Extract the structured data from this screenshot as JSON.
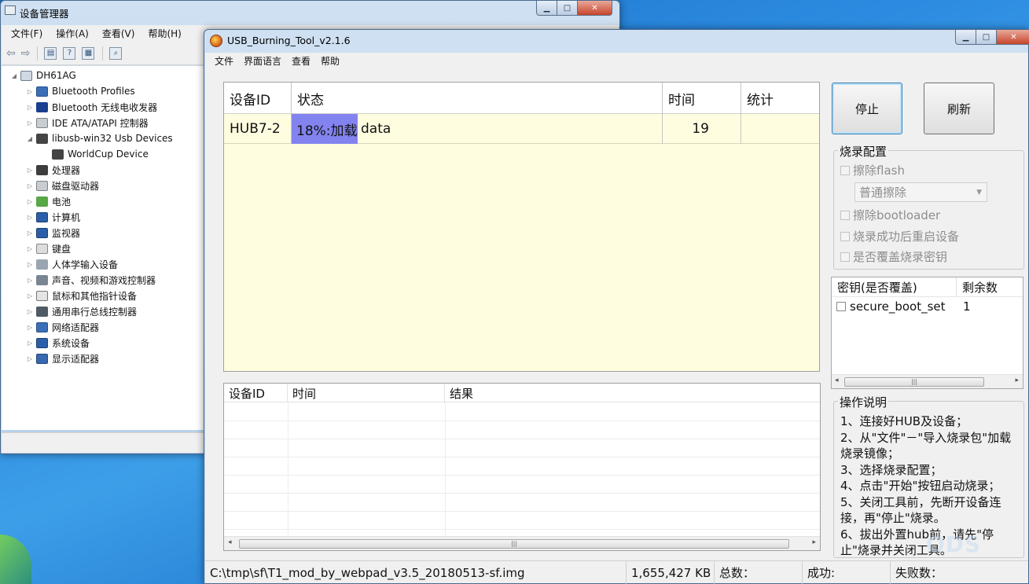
{
  "device_manager": {
    "title": "设备管理器",
    "menu": [
      "文件(F)",
      "操作(A)",
      "查看(V)",
      "帮助(H)"
    ],
    "tree": [
      {
        "label": "DH61AG",
        "icon": "computer-icon",
        "level": 0,
        "expanded": true
      },
      {
        "label": "Bluetooth Profiles",
        "icon": "network-icon",
        "level": 1
      },
      {
        "label": "Bluetooth 无线电收发器",
        "icon": "bluetooth-icon",
        "level": 1
      },
      {
        "label": "IDE ATA/ATAPI 控制器",
        "icon": "drive-controller-icon",
        "level": 1
      },
      {
        "label": "libusb-win32 Usb Devices",
        "icon": "usb-icon",
        "level": 1,
        "expanded": true
      },
      {
        "label": "WorldCup Device",
        "icon": "usb-icon",
        "level": 2
      },
      {
        "label": "处理器",
        "icon": "cpu-icon",
        "level": 1
      },
      {
        "label": "磁盘驱动器",
        "icon": "disk-icon",
        "level": 1
      },
      {
        "label": "电池",
        "icon": "battery-icon",
        "level": 1
      },
      {
        "label": "计算机",
        "icon": "monitor-icon",
        "level": 1
      },
      {
        "label": "监视器",
        "icon": "monitor-icon",
        "level": 1
      },
      {
        "label": "键盘",
        "icon": "keyboard-icon",
        "level": 1
      },
      {
        "label": "人体学输入设备",
        "icon": "hid-icon",
        "level": 1
      },
      {
        "label": "声音、视频和游戏控制器",
        "icon": "sound-icon",
        "level": 1
      },
      {
        "label": "鼠标和其他指针设备",
        "icon": "mouse-icon",
        "level": 1
      },
      {
        "label": "通用串行总线控制器",
        "icon": "usb-bus-icon",
        "level": 1
      },
      {
        "label": "网络适配器",
        "icon": "network-icon",
        "level": 1
      },
      {
        "label": "系统设备",
        "icon": "monitor-icon",
        "level": 1
      },
      {
        "label": "显示适配器",
        "icon": "display-adapter-icon",
        "level": 1
      }
    ]
  },
  "usb_tool": {
    "title": "USB_Burning_Tool_v2.1.6",
    "menu": [
      "文件",
      "界面语言",
      "查看",
      "帮助"
    ],
    "device_table": {
      "headers": [
        "设备ID",
        "状态",
        "时间",
        "统计"
      ],
      "rows": [
        {
          "device_id": "HUB7-2",
          "status_progress": "18%:加载",
          "status_rest": "data",
          "progress": 0.18,
          "time": "19",
          "stats": ""
        }
      ]
    },
    "result_table": {
      "headers": [
        "设备ID",
        "时间",
        "结果"
      ]
    },
    "buttons": {
      "stop": "停止",
      "refresh": "刷新"
    },
    "burn_config": {
      "title": "烧录配置",
      "erase_flash": "擦除flash",
      "erase_mode": "普通擦除",
      "erase_bootloader": "擦除bootloader",
      "reboot_after": "烧录成功后重启设备",
      "overwrite_key": "是否覆盖烧录密钥"
    },
    "key_list": {
      "headers": [
        "密钥(是否覆盖)",
        "剩余数"
      ],
      "rows": [
        {
          "name": "secure_boot_set",
          "remaining": "1"
        }
      ]
    },
    "instructions": {
      "title": "操作说明",
      "lines": [
        "1、连接好HUB及设备；",
        "2、从\"文件\"－\"导入烧录包\"加载烧录镜像；",
        "3、选择烧录配置；",
        "4、点击\"开始\"按钮启动烧录；",
        "5、关闭工具前，先断开设备连接，再\"停止\"烧录。",
        "6、拔出外置hub前，请先\"停止\"烧录并关闭工具。"
      ]
    },
    "status_bar": {
      "path": "C:\\tmp\\sf\\T1_mod_by_webpad_v3.5_20180513-sf.img",
      "size": "1,655,427 KB",
      "total": "总数：",
      "success": "成功:",
      "fail": "失败数："
    }
  },
  "colors": {
    "progress": "#8383f0",
    "device_table_bg": "#fffde0",
    "desktop": "#2c8be0"
  }
}
